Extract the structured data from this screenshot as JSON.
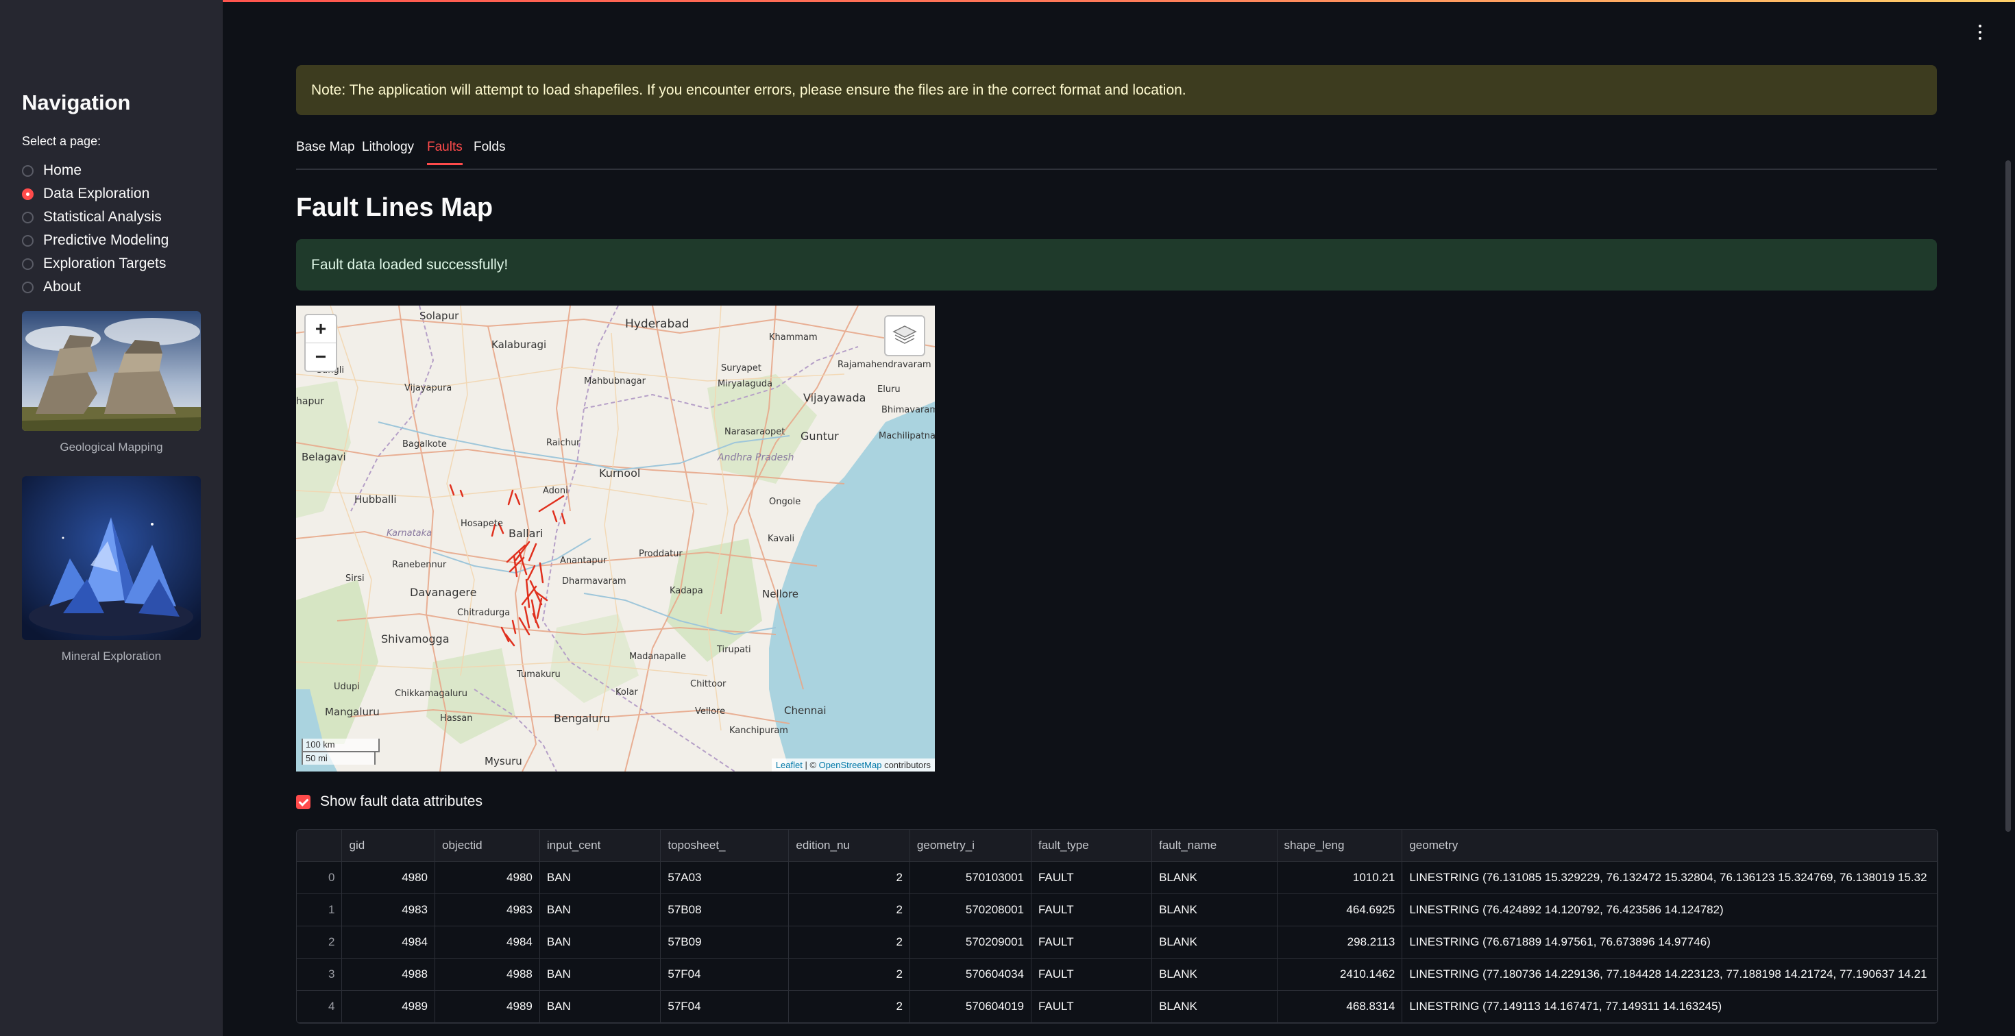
{
  "sidebar": {
    "title": "Navigation",
    "select_label": "Select a page:",
    "pages": [
      {
        "label": "Home",
        "selected": false
      },
      {
        "label": "Data Exploration",
        "selected": true
      },
      {
        "label": "Statistical Analysis",
        "selected": false
      },
      {
        "label": "Predictive Modeling",
        "selected": false
      },
      {
        "label": "Exploration Targets",
        "selected": false
      },
      {
        "label": "About",
        "selected": false
      }
    ],
    "images": [
      {
        "caption": "Geological Mapping"
      },
      {
        "caption": "Mineral Exploration"
      }
    ]
  },
  "note": "Note: The application will attempt to load shapefiles. If you encounter errors, please ensure the files are in the correct format and location.",
  "tabs": [
    "Base Map",
    "Lithology",
    "Faults",
    "Folds"
  ],
  "active_tab": "Faults",
  "page_title": "Fault Lines Map",
  "success_message": "Fault data loaded successfully!",
  "map": {
    "zoom_in": "+",
    "zoom_out": "−",
    "scale_km": "100 km",
    "scale_mi": "50 mi",
    "attribution_leaflet": "Leaflet",
    "attribution_sep": " | © ",
    "attribution_osm": "OpenStreetMap",
    "attribution_tail": " contributors",
    "cities": {
      "solapur": "Solapur",
      "kalaburagi": "Kalaburagi",
      "hyderabad": "Hyderabad",
      "khammam": "Khammam",
      "rajamahendravaram": "Rajamahendravaram",
      "sangli": "Sangli",
      "vijayapura": "Vijayapura",
      "mahbubnagar": "Mahbubnagar",
      "suryapet": "Suryapet",
      "miryalaguda": "Miryalaguda",
      "eluru": "Eluru",
      "vijayawada": "Vijayawada",
      "bhimavaram": "Bhimavaram",
      "kolhapur": "hapur",
      "narasaraopet": "Narasaraopet",
      "machilipatnam": "Machilipatna",
      "belagavi": "Belagavi",
      "bagalkote": "Bagalkote",
      "raichur": "Raichur",
      "guntur": "Guntur",
      "andhra": "Andhra Pradesh",
      "kurnool": "Kurnool",
      "adoni": "Adoni",
      "hubballi": "Hubballi",
      "ongole": "Ongole",
      "karnataka": "Karnataka",
      "hosapete": "Hosapete",
      "ballari": "Ballari",
      "kavali": "Kavali",
      "ranebennur": "Ranebennur",
      "anantapur": "Anantapur",
      "proddatur": "Proddatur",
      "sirsi": "Sirsi",
      "dharmavaram": "Dharmavaram",
      "davanagere": "Davanagere",
      "kadapa": "Kadapa",
      "nellore": "Nellore",
      "chitradurga": "Chitradurga",
      "shivamogga": "Shivamogga",
      "tirupati": "Tirupati",
      "madanapalle": "Madanapalle",
      "udupi": "Udupi",
      "tumakuru": "Tumakuru",
      "chittoor": "Chittoor",
      "chikkamagaluru": "Chikkamagaluru",
      "kolar": "Kolar",
      "mangaluru": "Mangaluru",
      "hassan": "Hassan",
      "vellore": "Vellore",
      "chennai": "Chennai",
      "bengaluru": "Bengaluru",
      "kanchipuram": "Kanchipuram",
      "mysuru": "Mysuru"
    }
  },
  "checkbox_label": "Show fault data attributes",
  "table": {
    "columns": [
      "",
      "gid",
      "objectid",
      "input_cent",
      "toposheet_",
      "edition_nu",
      "geometry_i",
      "fault_type",
      "fault_name",
      "shape_leng",
      "geometry"
    ],
    "rows": [
      [
        "0",
        "4980",
        "4980",
        "BAN",
        "57A03",
        "2",
        "570103001",
        "FAULT",
        "BLANK",
        "1010.21",
        "LINESTRING (76.131085 15.329229, 76.132472 15.32804, 76.136123 15.324769, 76.138019 15.32"
      ],
      [
        "1",
        "4983",
        "4983",
        "BAN",
        "57B08",
        "2",
        "570208001",
        "FAULT",
        "BLANK",
        "464.6925",
        "LINESTRING (76.424892 14.120792, 76.423586 14.124782)"
      ],
      [
        "2",
        "4984",
        "4984",
        "BAN",
        "57B09",
        "2",
        "570209001",
        "FAULT",
        "BLANK",
        "298.2113",
        "LINESTRING (76.671889 14.97561, 76.673896 14.97746)"
      ],
      [
        "3",
        "4988",
        "4988",
        "BAN",
        "57F04",
        "2",
        "570604034",
        "FAULT",
        "BLANK",
        "2410.1462",
        "LINESTRING (77.180736 14.229136, 77.184428 14.223123, 77.188198 14.21724, 77.190637 14.21"
      ],
      [
        "4",
        "4989",
        "4989",
        "BAN",
        "57F04",
        "2",
        "570604019",
        "FAULT",
        "BLANK",
        "468.8314",
        "LINESTRING (77.149113 14.167471, 77.149311 14.163245)"
      ]
    ]
  },
  "colors": {
    "accent": "#ff4b4b",
    "fault_line": "#e0301e",
    "water": "#aad3df"
  }
}
